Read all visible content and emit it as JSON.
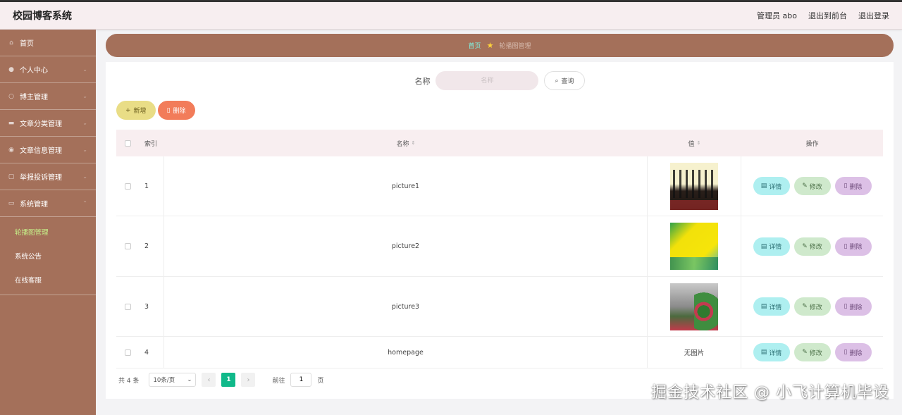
{
  "header": {
    "brand": "校园博客系统",
    "admin_label": "管理员 abo",
    "front_label": "退出到前台",
    "logout_label": "退出登录"
  },
  "sidebar": {
    "items": [
      {
        "label": "首页",
        "icon": "home-icon"
      },
      {
        "label": "个人中心",
        "icon": "user-icon"
      },
      {
        "label": "博主管理",
        "icon": "blogger-icon"
      },
      {
        "label": "文章分类管理",
        "icon": "category-icon"
      },
      {
        "label": "文章信息管理",
        "icon": "article-icon"
      },
      {
        "label": "举报投诉管理",
        "icon": "report-icon"
      },
      {
        "label": "系统管理",
        "icon": "system-icon"
      }
    ],
    "subitems": [
      {
        "label": "轮播图管理",
        "active": true
      },
      {
        "label": "系统公告",
        "active": false
      },
      {
        "label": "在线客服",
        "active": false
      }
    ]
  },
  "breadcrumb": {
    "home": "首页",
    "current": "轮播图管理"
  },
  "search": {
    "label": "名称",
    "placeholder": "名称",
    "button": "查询"
  },
  "toolbar": {
    "add_label": "新增",
    "delete_label": "删除"
  },
  "table": {
    "headers": {
      "index": "索引",
      "name": "名称",
      "value": "值",
      "ops": "操作"
    },
    "rows": [
      {
        "index": "1",
        "name": "picture1",
        "image": "img1",
        "value_text": ""
      },
      {
        "index": "2",
        "name": "picture2",
        "image": "img2",
        "value_text": ""
      },
      {
        "index": "3",
        "name": "picture3",
        "image": "img3",
        "value_text": ""
      },
      {
        "index": "4",
        "name": "homepage",
        "image": "",
        "value_text": "无图片"
      }
    ],
    "op_labels": {
      "detail": "详情",
      "edit": "修改",
      "delete": "删除"
    }
  },
  "pager": {
    "total": "共 4 条",
    "page_size": "10条/页",
    "current_page": "1",
    "goto_prefix": "前往",
    "goto_value": "1",
    "goto_suffix": "页"
  },
  "watermark": "掘金技术社区 @ 小飞计算机毕设",
  "colors": {
    "sidebar": "#a4705a",
    "accent_green": "#10b98a",
    "add_btn": "#e9dd86",
    "del_btn": "#f27c5a"
  }
}
